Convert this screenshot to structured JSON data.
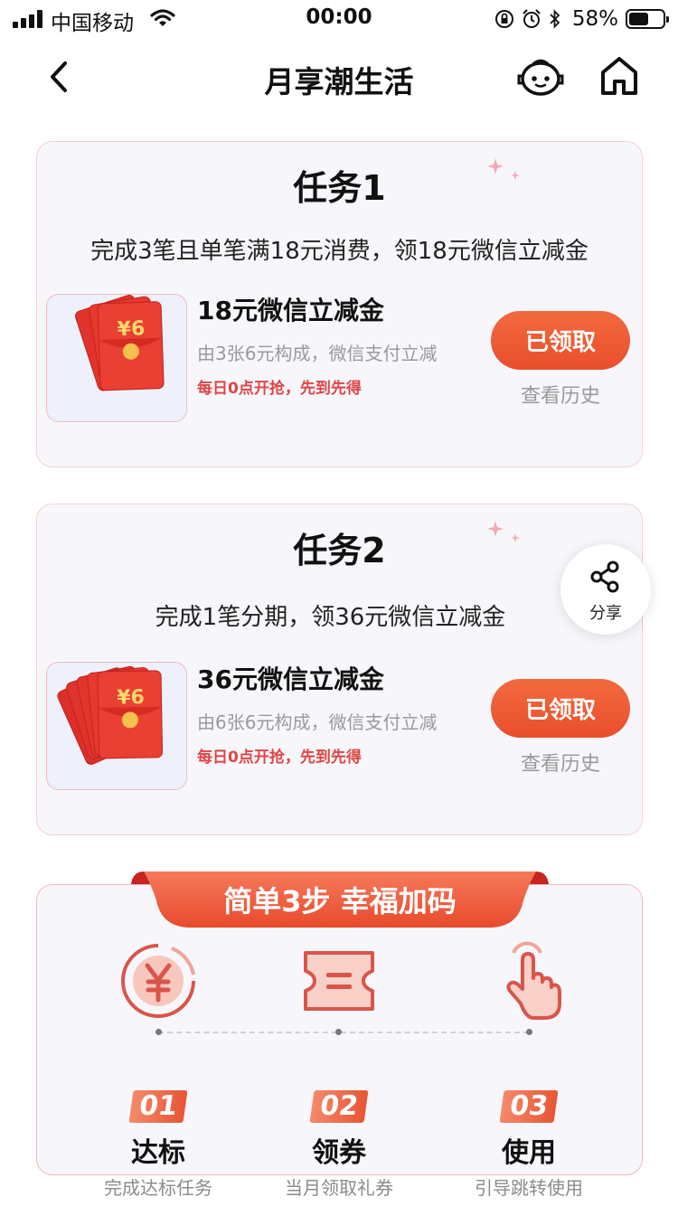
{
  "status": {
    "carrier": "中国移动",
    "time": "00:00",
    "battery": "58%",
    "battery_level": 0.58
  },
  "nav": {
    "title": "月享潮生活"
  },
  "tasks": [
    {
      "title": "任务1",
      "desc": "完成3笔且单笔满18元消费，领18元微信立减金",
      "prize_name": "18元微信立减金",
      "prize_sub": "由3张6元构成，微信支付立减",
      "prize_note": "每日0点开抢，先到先得",
      "thumb_value": "¥6",
      "button": "已领取",
      "history": "查看历史"
    },
    {
      "title": "任务2",
      "desc": "完成1笔分期，领36元微信立减金",
      "prize_name": "36元微信立减金",
      "prize_sub": "由6张6元构成，微信支付立减",
      "prize_note": "每日0点开抢，先到先得",
      "thumb_value": "¥6",
      "button": "已领取",
      "history": "查看历史"
    }
  ],
  "share": {
    "label": "分享"
  },
  "steps": {
    "banner": "简单3步 幸福加码",
    "items": [
      {
        "num": "01",
        "name": "达标",
        "desc": "完成达标任务",
        "icon": "yuan-coin-icon"
      },
      {
        "num": "02",
        "name": "领券",
        "desc": "当月领取礼券",
        "icon": "ticket-icon"
      },
      {
        "num": "03",
        "name": "使用",
        "desc": "引导跳转使用",
        "icon": "tap-hand-icon"
      }
    ]
  },
  "colors": {
    "accent": "#e84f2b",
    "border": "#f4b8c0",
    "card_bg": "#f7f7fb"
  }
}
